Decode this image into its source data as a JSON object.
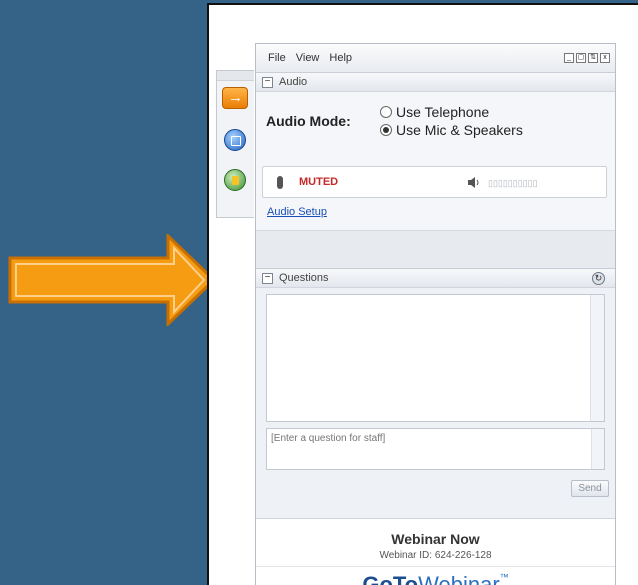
{
  "menu": {
    "file": "File",
    "view": "View",
    "help": "Help"
  },
  "window_controls": {
    "minimize": "_",
    "restore": "▢",
    "grab": "⇅",
    "close": "x"
  },
  "audio": {
    "section_label": "Audio",
    "mode_label": "Audio Mode:",
    "option_telephone": "Use Telephone",
    "option_mic": "Use Mic & Speakers",
    "selected": "mic",
    "mute_status": "MUTED",
    "volume_meter": "▯▯▯▯▯▯▯▯▯▯",
    "setup_link": "Audio Setup"
  },
  "questions": {
    "section_label": "Questions",
    "input_placeholder": "[Enter a question for staff]",
    "send_label": "Send"
  },
  "footer": {
    "title": "Webinar Now",
    "webinar_id": "Webinar ID: 624-226-128",
    "brand_goto": "GoTo",
    "brand_webinar": "Webinar",
    "brand_tm": "™"
  },
  "colors": {
    "background": "#356387",
    "arrow": "#f59c12",
    "muted": "#c62828",
    "link": "#1a4fb5",
    "brand": "#1d4e8f"
  },
  "icons": {
    "sidebar": [
      "arrow-orange-icon",
      "screen-blue-icon",
      "lock-green-icon"
    ],
    "questions_head": "refresh-icon"
  }
}
